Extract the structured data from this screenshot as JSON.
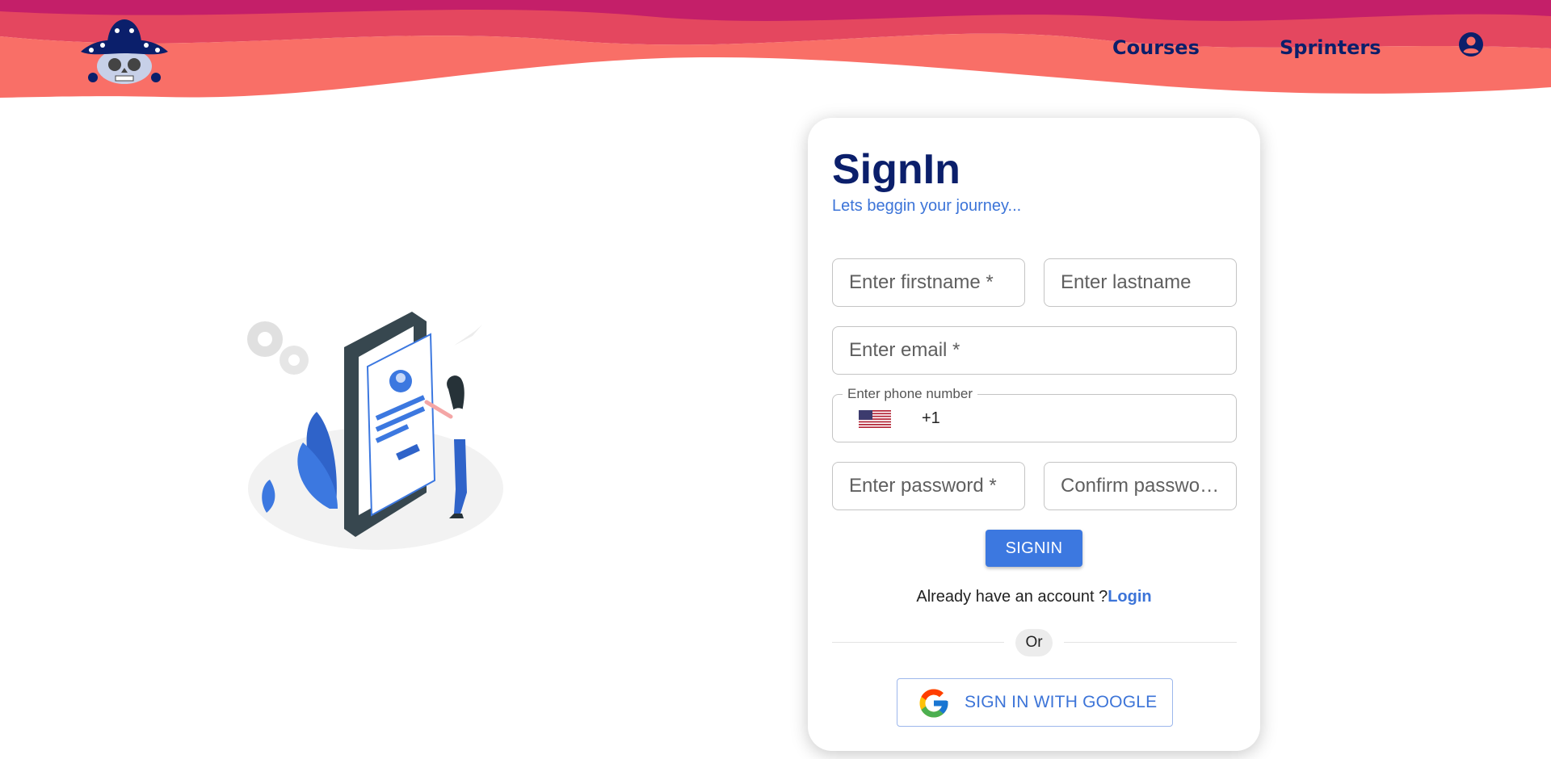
{
  "header": {
    "nav": {
      "courses": "Courses",
      "sprinters": "Sprinters"
    },
    "colors": {
      "wave_dark": "#c41f69",
      "wave_mid": "#e4475f",
      "wave_light": "#f96f67",
      "nav_text": "#0b1f6b"
    }
  },
  "form": {
    "title": "SignIn",
    "subtitle": "Lets beggin your journey...",
    "firstname_placeholder": "Enter firstname *",
    "lastname_placeholder": "Enter lastname",
    "email_placeholder": "Enter email *",
    "phone_label": "Enter phone number",
    "phone_country_flag": "us-flag-icon",
    "phone_dial_code": "+1",
    "password_placeholder": "Enter password *",
    "confirm_placeholder": "Confirm password *",
    "submit_label": "SIGNIN",
    "account_prompt": "Already have an account ?",
    "login_link": "Login",
    "divider_text": "Or",
    "google_label": "SIGN IN WITH GOOGLE",
    "accent_color": "#3c78e0"
  }
}
